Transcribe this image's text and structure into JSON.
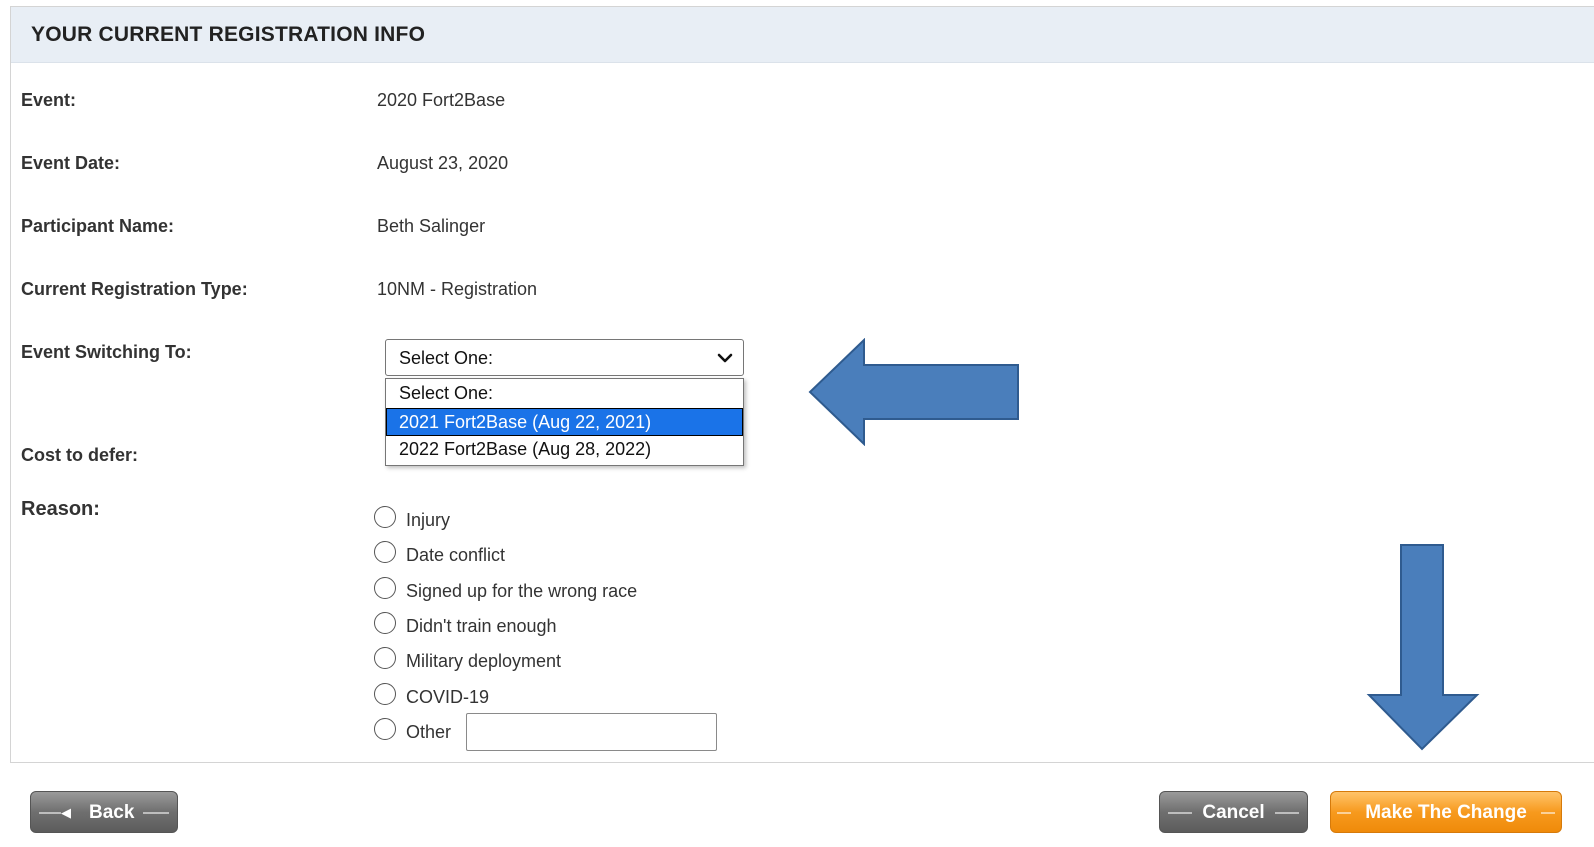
{
  "panel": {
    "title": "YOUR CURRENT REGISTRATION INFO"
  },
  "fields": {
    "event_label": "Event:",
    "event_value": "2020 Fort2Base",
    "event_date_label": "Event Date:",
    "event_date_value": "August 23, 2020",
    "participant_label": "Participant Name:",
    "participant_value": "Beth Salinger",
    "reg_type_label": "Current Registration Type:",
    "reg_type_value": "10NM - Registration",
    "switching_label": "Event Switching To:",
    "cost_label": "Cost to defer:",
    "reason_label": "Reason:"
  },
  "event_select": {
    "selected_display": "Select One:",
    "options": [
      "Select One:",
      "2021 Fort2Base (Aug 22, 2021)",
      "2022 Fort2Base (Aug 28, 2022)"
    ],
    "highlighted_index": 1
  },
  "reasons": [
    "Injury",
    "Date conflict",
    "Signed up for the wrong race",
    "Didn't train enough",
    "Military deployment",
    "COVID-19",
    "Other"
  ],
  "buttons": {
    "back": "Back",
    "cancel": "Cancel",
    "make_change": "Make The Change"
  },
  "colors": {
    "header_bg": "#e8eef5",
    "highlight": "#1a73e8",
    "annotation_arrow": "#4a7ebb",
    "primary_button": "#f79a1e",
    "secondary_button": "#6f6f6f"
  }
}
